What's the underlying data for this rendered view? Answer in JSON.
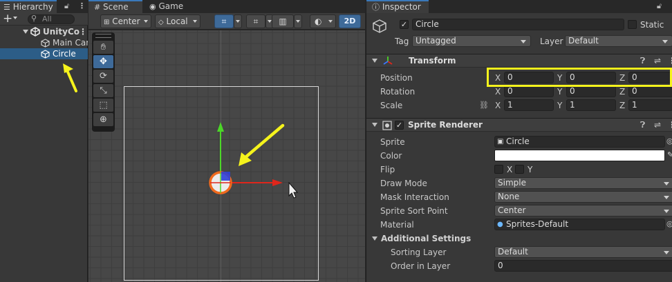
{
  "hierarchy": {
    "tab_label": "Hierarchy",
    "search_placeholder": "All",
    "items": [
      {
        "label": "UnityCo",
        "indent": 0
      },
      {
        "label": "Main Cam",
        "indent": 1
      },
      {
        "label": "Circle",
        "indent": 1,
        "selected": true
      }
    ]
  },
  "scene": {
    "tabs": [
      {
        "label": "Scene"
      },
      {
        "label": "Game"
      }
    ],
    "toolbar": {
      "pivot": "Center",
      "space": "Local",
      "mode_2d": "2D"
    },
    "tools": [
      "hand-tool",
      "move-tool",
      "rotate-tool",
      "scale-tool",
      "rect-tool",
      "transform-tool"
    ],
    "active_tool": "move-tool"
  },
  "inspector": {
    "tab_label": "Inspector",
    "object": {
      "name": "Circle",
      "enabled": true,
      "static_label": "Static",
      "tag_label": "Tag",
      "tag_value": "Untagged",
      "layer_label": "Layer",
      "layer_value": "Default"
    },
    "transform": {
      "title": "Transform",
      "rows": {
        "position": {
          "label": "Position",
          "x": "0",
          "y": "0",
          "z": "0"
        },
        "rotation": {
          "label": "Rotation",
          "x": "0",
          "y": "0",
          "z": "0"
        },
        "scale": {
          "label": "Scale",
          "x": "1",
          "y": "1",
          "z": "1"
        }
      },
      "axes": {
        "x": "X",
        "y": "Y",
        "z": "Z"
      }
    },
    "sprite_renderer": {
      "title": "Sprite Renderer",
      "enabled": true,
      "sprite": {
        "label": "Sprite",
        "value": "Circle"
      },
      "color": {
        "label": "Color",
        "value": "#ffffff"
      },
      "flip": {
        "label": "Flip",
        "x": "X",
        "y": "Y"
      },
      "draw_mode": {
        "label": "Draw Mode",
        "value": "Simple"
      },
      "mask_interaction": {
        "label": "Mask Interaction",
        "value": "None"
      },
      "sprite_sort_point": {
        "label": "Sprite Sort Point",
        "value": "Center"
      },
      "material": {
        "label": "Material",
        "value": "Sprites-Default"
      },
      "additional": {
        "title": "Additional Settings",
        "sorting_layer": {
          "label": "Sorting Layer",
          "value": "Default"
        },
        "order_in_layer": {
          "label": "Order in Layer",
          "value": "0"
        }
      }
    }
  },
  "colors": {
    "accent": "#3a79bb",
    "selection": "#2c5d87",
    "annotation": "#f5f31c",
    "gizmo_x": "#e0261b",
    "gizmo_y": "#4cd628",
    "sprite_outline": "#f06a1e"
  }
}
